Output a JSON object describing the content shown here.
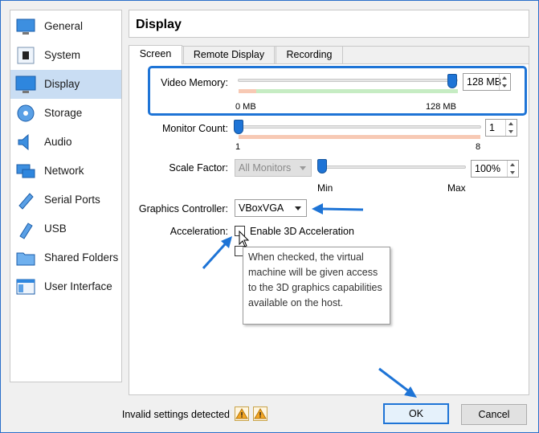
{
  "sidebar": {
    "items": [
      {
        "label": "General",
        "icon": "general-icon"
      },
      {
        "label": "System",
        "icon": "system-icon"
      },
      {
        "label": "Display",
        "icon": "display-icon",
        "active": true
      },
      {
        "label": "Storage",
        "icon": "storage-icon"
      },
      {
        "label": "Audio",
        "icon": "audio-icon"
      },
      {
        "label": "Network",
        "icon": "network-icon"
      },
      {
        "label": "Serial Ports",
        "icon": "serial-ports-icon"
      },
      {
        "label": "USB",
        "icon": "usb-icon"
      },
      {
        "label": "Shared Folders",
        "icon": "shared-folders-icon"
      },
      {
        "label": "User Interface",
        "icon": "user-interface-icon"
      }
    ]
  },
  "header": {
    "title": "Display"
  },
  "tabs": [
    {
      "label": "Screen",
      "active": true
    },
    {
      "label": "Remote Display"
    },
    {
      "label": "Recording"
    }
  ],
  "screen": {
    "video_memory": {
      "label": "Video Memory:",
      "value": "128 MB",
      "min_label": "0 MB",
      "max_label": "128 MB",
      "level": 1.0
    },
    "monitor_count": {
      "label": "Monitor Count:",
      "value": "1",
      "min_label": "1",
      "max_label": "8",
      "level": 0.0
    },
    "scale_factor": {
      "label": "Scale Factor:",
      "monitor_select": "All Monitors",
      "value": "100%",
      "min_label": "Min",
      "max_label": "Max",
      "level": 0.0
    },
    "graphics_controller": {
      "label": "Graphics Controller:",
      "value": "VBoxVGA"
    },
    "acceleration": {
      "label": "Acceleration:",
      "enable_3d_label": "Enable 3D Acceleration",
      "enable_3d_checked": false
    }
  },
  "tooltip": {
    "text": "When checked, the virtual machine will be given access to the 3D graphics capabilities available on the host."
  },
  "footer": {
    "status_text": "Invalid settings detected",
    "ok_label": "OK",
    "cancel_label": "Cancel"
  },
  "colors": {
    "accent": "#1e74d6",
    "selection": "#c9ddf3",
    "warning": "#f5a623"
  }
}
